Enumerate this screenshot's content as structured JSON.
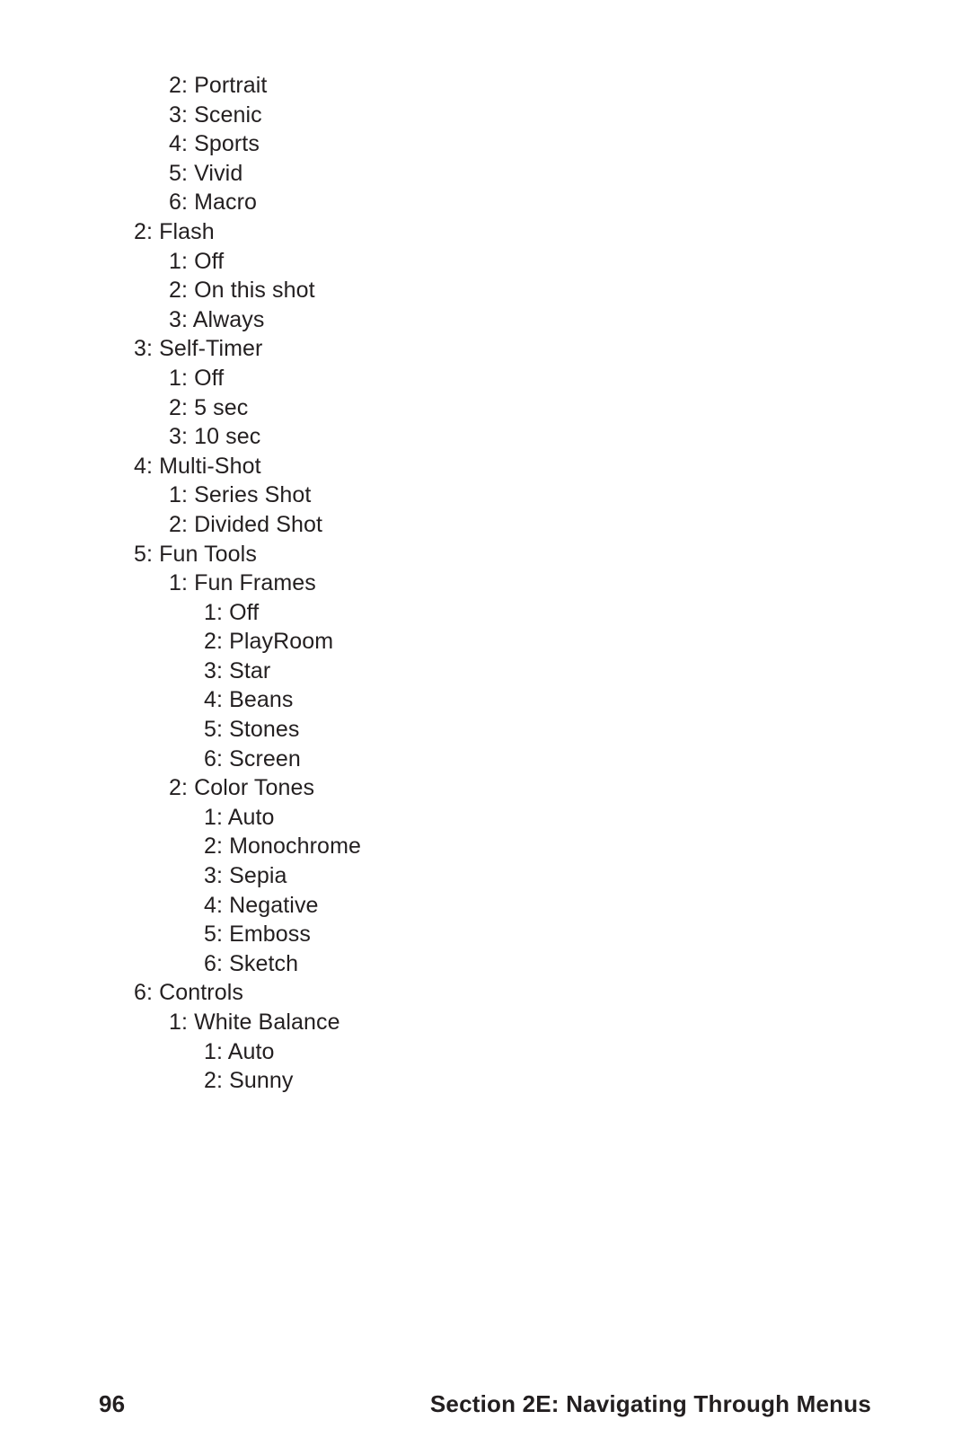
{
  "page_number": "96",
  "section_label": "Section 2E: Navigating Through Menus",
  "lines": [
    {
      "indent": 1,
      "text": "2: Portrait"
    },
    {
      "indent": 1,
      "text": "3: Scenic"
    },
    {
      "indent": 1,
      "text": "4: Sports"
    },
    {
      "indent": 1,
      "text": "5: Vivid"
    },
    {
      "indent": 1,
      "text": "6: Macro"
    },
    {
      "indent": 0,
      "text": "2: Flash"
    },
    {
      "indent": 1,
      "text": "1: Off"
    },
    {
      "indent": 1,
      "text": "2: On this shot"
    },
    {
      "indent": 1,
      "text": "3: Always"
    },
    {
      "indent": 0,
      "text": "3: Self-Timer"
    },
    {
      "indent": 1,
      "text": "1: Off"
    },
    {
      "indent": 1,
      "text": "2: 5 sec"
    },
    {
      "indent": 1,
      "text": "3: 10 sec"
    },
    {
      "indent": 0,
      "text": "4: Multi-Shot"
    },
    {
      "indent": 1,
      "text": "1: Series Shot"
    },
    {
      "indent": 1,
      "text": "2: Divided Shot"
    },
    {
      "indent": 0,
      "text": "5: Fun Tools"
    },
    {
      "indent": 1,
      "text": "1: Fun Frames"
    },
    {
      "indent": 2,
      "text": "1: Off"
    },
    {
      "indent": 2,
      "text": "2: PlayRoom"
    },
    {
      "indent": 2,
      "text": "3: Star"
    },
    {
      "indent": 2,
      "text": "4: Beans"
    },
    {
      "indent": 2,
      "text": "5: Stones"
    },
    {
      "indent": 2,
      "text": "6: Screen"
    },
    {
      "indent": 1,
      "text": "2: Color Tones"
    },
    {
      "indent": 2,
      "text": "1: Auto"
    },
    {
      "indent": 2,
      "text": "2: Monochrome"
    },
    {
      "indent": 2,
      "text": "3: Sepia"
    },
    {
      "indent": 2,
      "text": "4: Negative"
    },
    {
      "indent": 2,
      "text": "5: Emboss"
    },
    {
      "indent": 2,
      "text": "6: Sketch"
    },
    {
      "indent": 0,
      "text": "6: Controls"
    },
    {
      "indent": 1,
      "text": "1: White Balance"
    },
    {
      "indent": 2,
      "text": "1: Auto"
    },
    {
      "indent": 2,
      "text": "2: Sunny"
    }
  ]
}
